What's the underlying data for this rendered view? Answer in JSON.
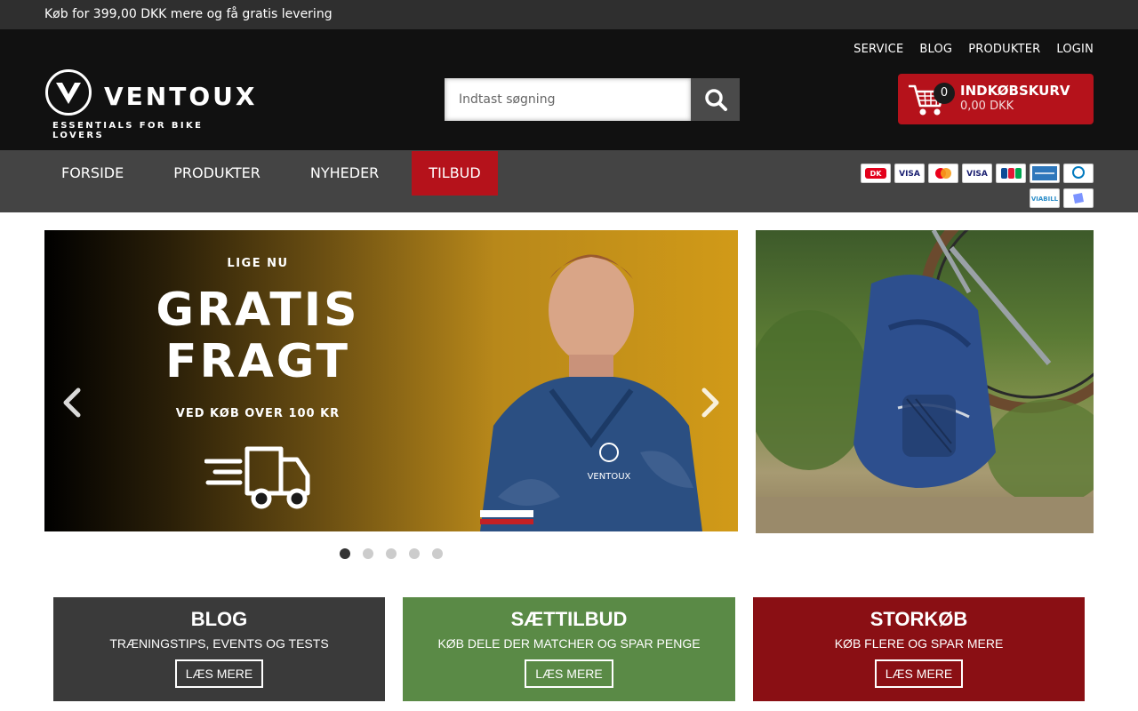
{
  "topbar": {
    "message": "Køb for 399,00 DKK mere og få gratis levering"
  },
  "toplinks": [
    "SERVICE",
    "BLOG",
    "PRODUKTER",
    "LOGIN"
  ],
  "logo": {
    "word": "VENTOUX",
    "tagline": "ESSENTIALS FOR BIKE LOVERS"
  },
  "search": {
    "placeholder": "Indtast søgning"
  },
  "cart": {
    "count": "0",
    "title": "INDKØBSKURV",
    "total": "0,00 DKK"
  },
  "nav": {
    "items": [
      "FORSIDE",
      "PRODUKTER",
      "NYHEDER",
      "TILBUD"
    ],
    "active": "TILBUD"
  },
  "payments": {
    "row1": [
      "dankort-icon",
      "visa-electron-icon",
      "mastercard-icon",
      "visa-icon",
      "jcb-icon",
      "amex-icon",
      "diners-club-icon"
    ],
    "row2": [
      "viabill-icon",
      "mobilepay-icon"
    ]
  },
  "slider": {
    "eyebrow": "LIGE NU",
    "headline_1": "GRATIS",
    "headline_2": "FRAGT",
    "subline": "VED KØB OVER 100 KR",
    "jersey_brand": "VENTOUX",
    "slides_count": 5,
    "active_slide": 1
  },
  "banners": [
    {
      "title": "BLOG",
      "subtitle": "TRÆNINGSTIPS, EVENTS OG TESTS",
      "button": "LÆS MERE",
      "color": "#3a3a3a"
    },
    {
      "title": "SÆTTILBUD",
      "subtitle": "KØB DELE DER MATCHER OG SPAR PENGE",
      "button": "LÆS MERE",
      "color": "#5a8a46"
    },
    {
      "title": "STORKØB",
      "subtitle": "KØB FLERE OG SPAR MERE",
      "button": "LÆS MERE",
      "color": "#8a0f14"
    }
  ],
  "colors": {
    "accent_red": "#b5121b",
    "nav_bg": "#444444",
    "header_bg": "#111111",
    "topbar_bg": "#2f2f2f"
  }
}
